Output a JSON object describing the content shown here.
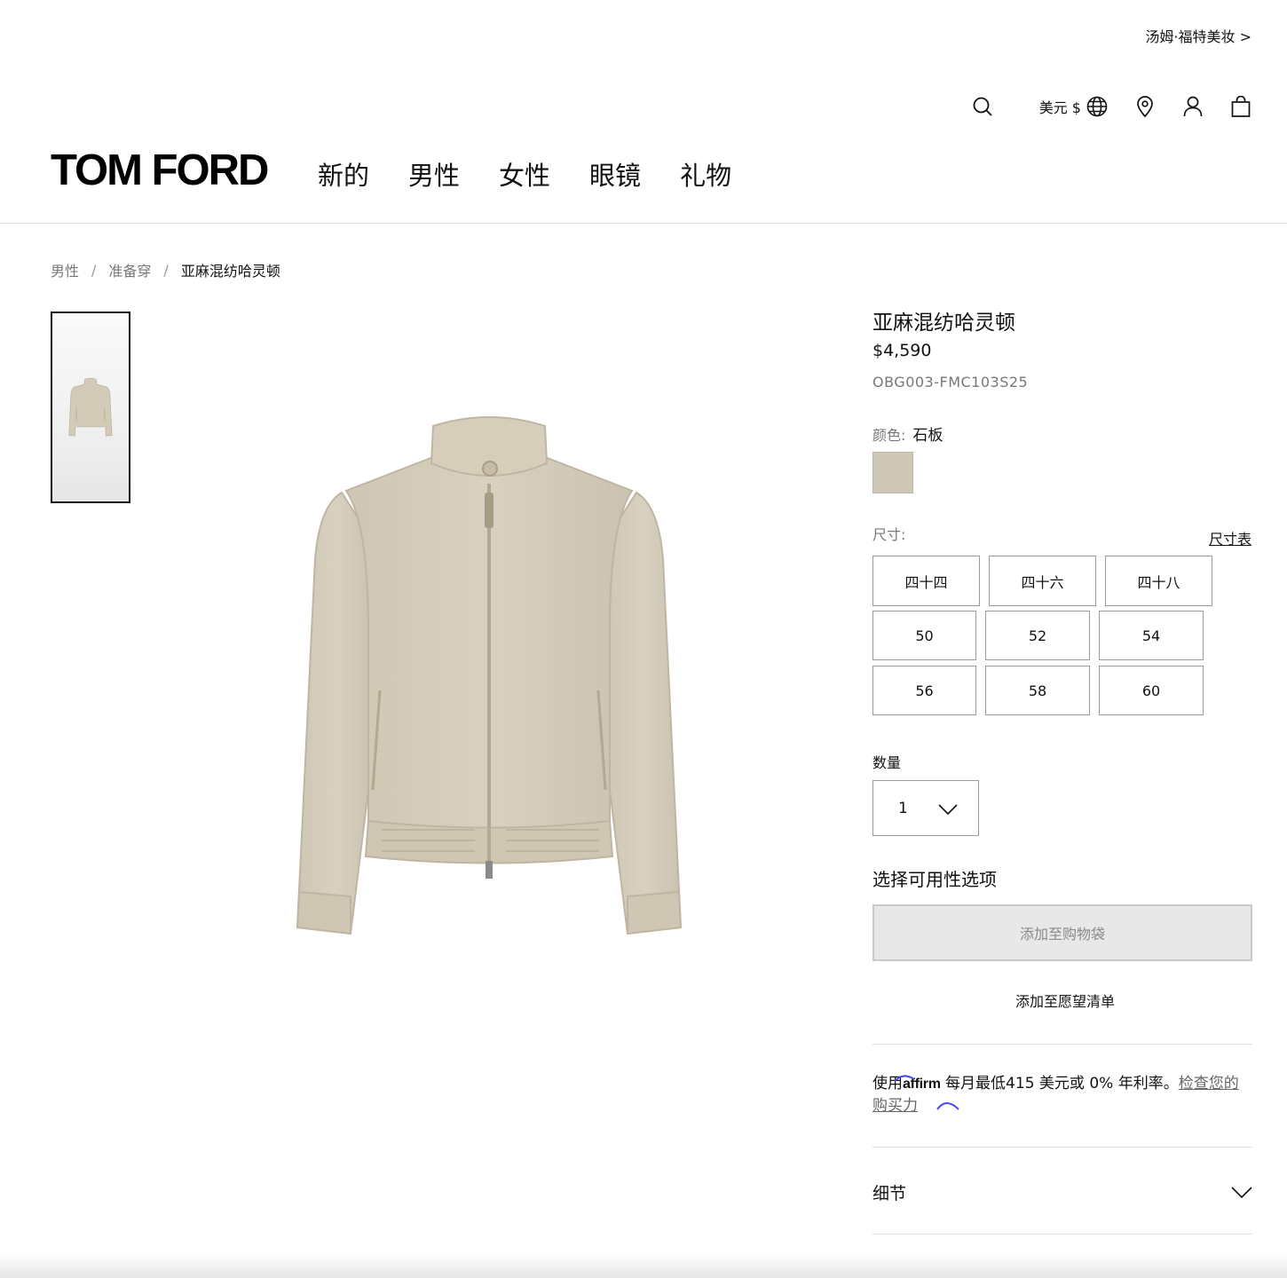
{
  "header": {
    "beauty_link": "汤姆·福特美妆 >",
    "currency": "美元 $",
    "logo": "TOM FORD",
    "nav": [
      "新的",
      "男性",
      "女性",
      "眼镜",
      "礼物"
    ]
  },
  "breadcrumb": {
    "items": [
      "男性",
      "准备穿"
    ],
    "separator": "/",
    "current": "亚麻混纺哈灵顿"
  },
  "product": {
    "title": "亚麻混纺哈灵顿",
    "price": "$4,590",
    "sku": "OBG003-FMC103S25",
    "color_label": "颜色:",
    "color_value": "石板",
    "swatch_color": "#cfc7b7",
    "size_label": "尺寸:",
    "size_chart": "尺寸表",
    "sizes": [
      "四十四",
      "四十六",
      "四十八",
      "50",
      "52",
      "54",
      "56",
      "58",
      "60"
    ],
    "qty_label": "数量",
    "qty_value": "1",
    "availability": "选择可用性选项",
    "add_to_bag": "添加至购物袋",
    "add_to_wishlist": "添加至愿望清单",
    "details": "细节"
  },
  "affirm": {
    "prefix": "使用",
    "brand": "affirm",
    "text": " 每月最低415 美元或 0% 年利率。",
    "link": "检查您的购买力"
  },
  "icons": [
    "search-icon",
    "globe-icon",
    "location-pin-icon",
    "user-icon",
    "shopping-bag-icon",
    "chevron-down-icon"
  ]
}
